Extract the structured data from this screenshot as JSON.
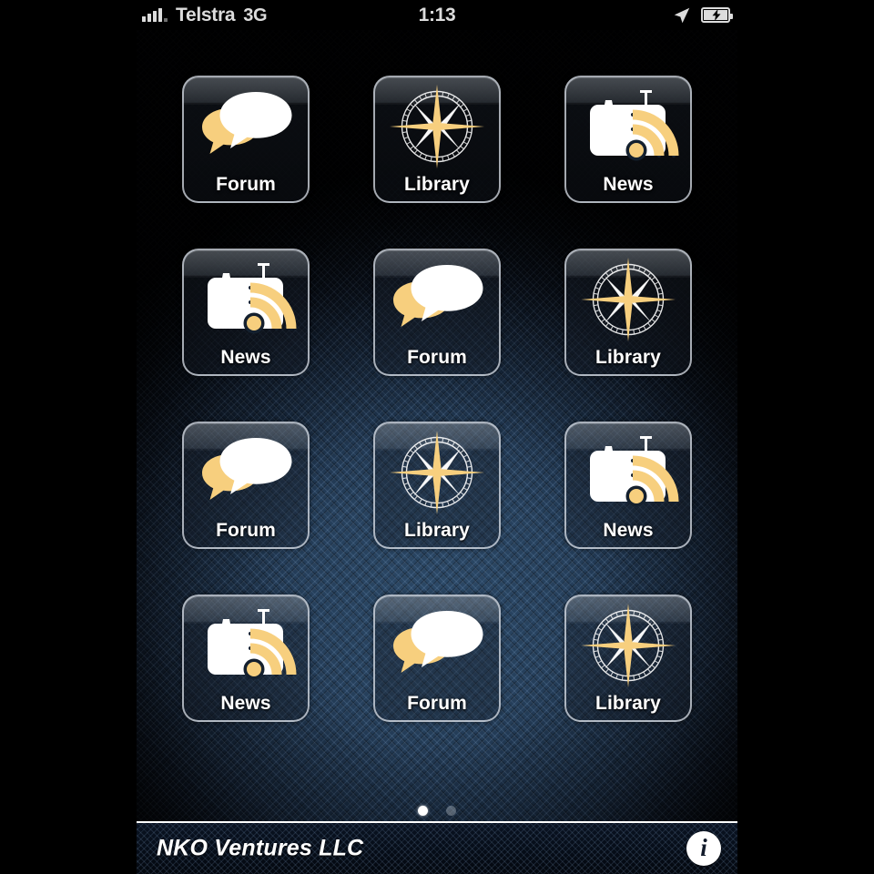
{
  "statusbar": {
    "carrier": "Telstra",
    "network": "3G",
    "time": "1:13",
    "signal_icon": "signal-bars-icon",
    "location_icon": "location-arrow-icon",
    "battery_icon": "battery-charging-icon"
  },
  "home": {
    "apps": [
      {
        "label": "Forum",
        "icon": "speech-bubbles-icon"
      },
      {
        "label": "Library",
        "icon": "compass-rose-icon"
      },
      {
        "label": "News",
        "icon": "radio-rss-icon"
      },
      {
        "label": "News",
        "icon": "radio-rss-icon"
      },
      {
        "label": "Forum",
        "icon": "speech-bubbles-icon"
      },
      {
        "label": "Library",
        "icon": "compass-rose-icon"
      },
      {
        "label": "Forum",
        "icon": "speech-bubbles-icon"
      },
      {
        "label": "Library",
        "icon": "compass-rose-icon"
      },
      {
        "label": "News",
        "icon": "radio-rss-icon"
      },
      {
        "label": "News",
        "icon": "radio-rss-icon"
      },
      {
        "label": "Forum",
        "icon": "speech-bubbles-icon"
      },
      {
        "label": "Library",
        "icon": "compass-rose-icon"
      }
    ],
    "pages": {
      "count": 2,
      "current": 1
    }
  },
  "bottombar": {
    "company": "NKO Ventures LLC",
    "info_label": "i",
    "info_icon": "info-circle-icon"
  },
  "colors": {
    "accent_gold": "#f7cf7e",
    "icon_white": "#ffffff",
    "bg_center": "#2b4866",
    "bg_edge": "#060a13",
    "label_text": "#ffffff"
  }
}
